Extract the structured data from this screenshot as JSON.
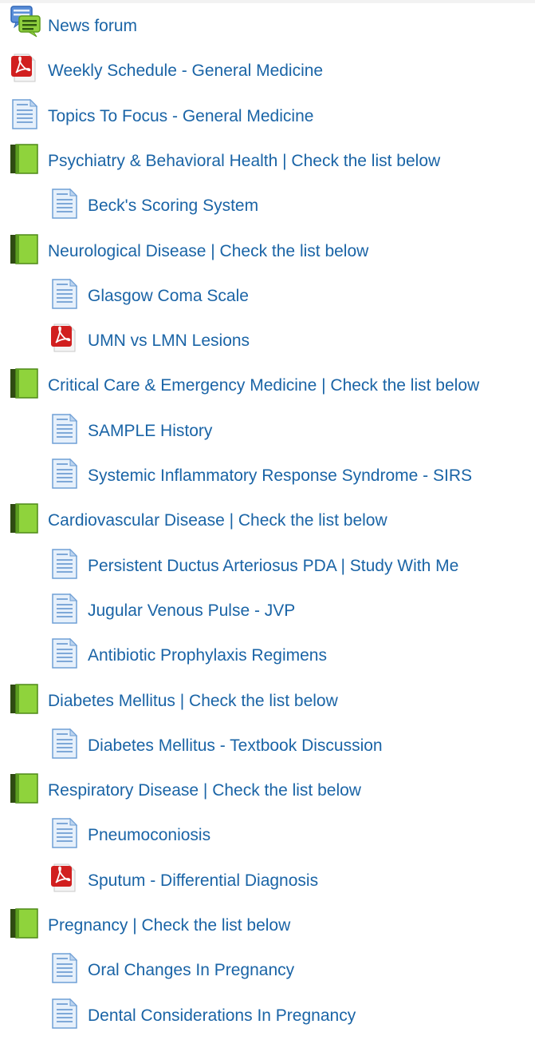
{
  "activities": [
    {
      "icon": "forum-icon",
      "label": "News forum",
      "level": 0
    },
    {
      "icon": "pdf-icon",
      "label": "Weekly Schedule - General Medicine",
      "level": 0
    },
    {
      "icon": "page-icon",
      "label": "Topics To Focus - General Medicine",
      "level": 0
    },
    {
      "icon": "book-icon",
      "label": "Psychiatry & Behavioral Health | Check the list below",
      "level": 0
    },
    {
      "icon": "page-icon",
      "label": "Beck's Scoring System",
      "level": 1
    },
    {
      "icon": "book-icon",
      "label": "Neurological Disease | Check the list below",
      "level": 0
    },
    {
      "icon": "page-icon",
      "label": "Glasgow Coma Scale",
      "level": 1
    },
    {
      "icon": "pdf-icon",
      "label": "UMN vs LMN Lesions",
      "level": 1
    },
    {
      "icon": "book-icon",
      "label": "Critical Care & Emergency Medicine | Check the list below",
      "level": 0
    },
    {
      "icon": "page-icon",
      "label": "SAMPLE History",
      "level": 1
    },
    {
      "icon": "page-icon",
      "label": "Systemic Inflammatory Response Syndrome - SIRS",
      "level": 1
    },
    {
      "icon": "book-icon",
      "label": "Cardiovascular Disease | Check the list below",
      "level": 0
    },
    {
      "icon": "page-icon",
      "label": "Persistent Ductus Arteriosus PDA | Study With Me",
      "level": 1
    },
    {
      "icon": "page-icon",
      "label": "Jugular Venous Pulse - JVP",
      "level": 1
    },
    {
      "icon": "page-icon",
      "label": "Antibiotic Prophylaxis Regimens",
      "level": 1
    },
    {
      "icon": "book-icon",
      "label": "Diabetes Mellitus | Check the list below",
      "level": 0
    },
    {
      "icon": "page-icon",
      "label": "Diabetes Mellitus - Textbook Discussion",
      "level": 1
    },
    {
      "icon": "book-icon",
      "label": "Respiratory Disease | Check the list below",
      "level": 0
    },
    {
      "icon": "page-icon",
      "label": "Pneumoconiosis",
      "level": 1
    },
    {
      "icon": "pdf-icon",
      "label": "Sputum - Differential Diagnosis",
      "level": 1
    },
    {
      "icon": "book-icon",
      "label": "Pregnancy | Check the list below",
      "level": 0
    },
    {
      "icon": "page-icon",
      "label": "Oral Changes In Pregnancy",
      "level": 1
    },
    {
      "icon": "page-icon",
      "label": "Dental Considerations In Pregnancy",
      "level": 1
    }
  ],
  "colors": {
    "link": "#1a64a6"
  }
}
